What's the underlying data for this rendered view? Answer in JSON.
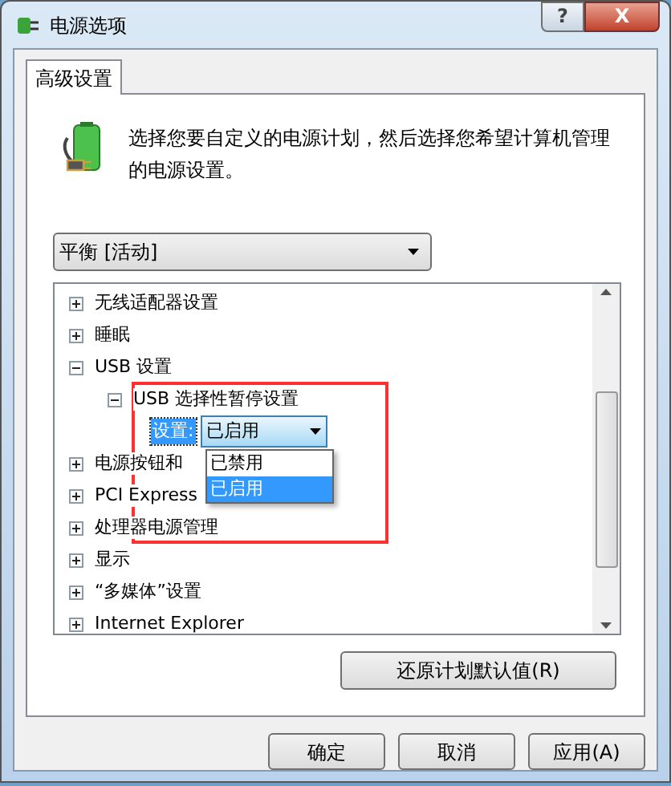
{
  "window": {
    "title": "电源选项",
    "buttons": [
      {
        "kind": "help",
        "label": "?"
      },
      {
        "kind": "close",
        "label": "X"
      }
    ]
  },
  "tabs": [
    {
      "label": "高级设置",
      "selected": true
    }
  ],
  "description": "选择您要自定义的电源计划，然后选择您希望计算机管理的电源设置。",
  "plan_select": {
    "value": "平衡 [活动]"
  },
  "tree": [
    {
      "label": "无线适配器设置",
      "expanded": false
    },
    {
      "label": "睡眠",
      "expanded": false
    },
    {
      "label": "USB 设置",
      "expanded": true,
      "children": [
        {
          "label": "USB 选择性暂停设置",
          "expanded": true,
          "children": [
            {
              "kind": "setting",
              "label": "设置:",
              "value": "已启用",
              "open": true,
              "options": [
                {
                  "label": "已禁用",
                  "selected": false
                },
                {
                  "label": "已启用",
                  "selected": true
                }
              ]
            }
          ]
        }
      ]
    },
    {
      "label": "电源按钮和",
      "expanded": false
    },
    {
      "label": "PCI Express",
      "expanded": false
    },
    {
      "label": "处理器电源管理",
      "expanded": false
    },
    {
      "label": "显示",
      "expanded": false
    },
    {
      "label": "“多媒体”设置",
      "expanded": false
    },
    {
      "label": "Internet Explorer",
      "expanded": false
    }
  ],
  "restore_button": "还原计划默认值(R)",
  "dialog_buttons": [
    "确定",
    "取消",
    "应用(A)"
  ]
}
